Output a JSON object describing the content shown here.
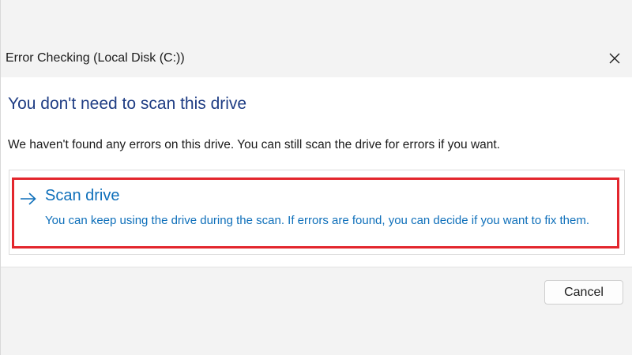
{
  "window": {
    "title": "Error Checking (Local Disk (C:))",
    "close_icon": "close-icon"
  },
  "content": {
    "heading": "You don't need to scan this drive",
    "message": "We haven't found any errors on this drive. You can still scan the drive for errors if you want.",
    "option": {
      "icon": "arrow-right-icon",
      "title": "Scan drive",
      "description": "You can keep using the drive during the scan. If errors are found, you can decide if you want to fix them."
    }
  },
  "footer": {
    "cancel_label": "Cancel"
  },
  "colors": {
    "heading": "#1f3d84",
    "link": "#0e6fba",
    "highlight_border": "#e3262d"
  }
}
